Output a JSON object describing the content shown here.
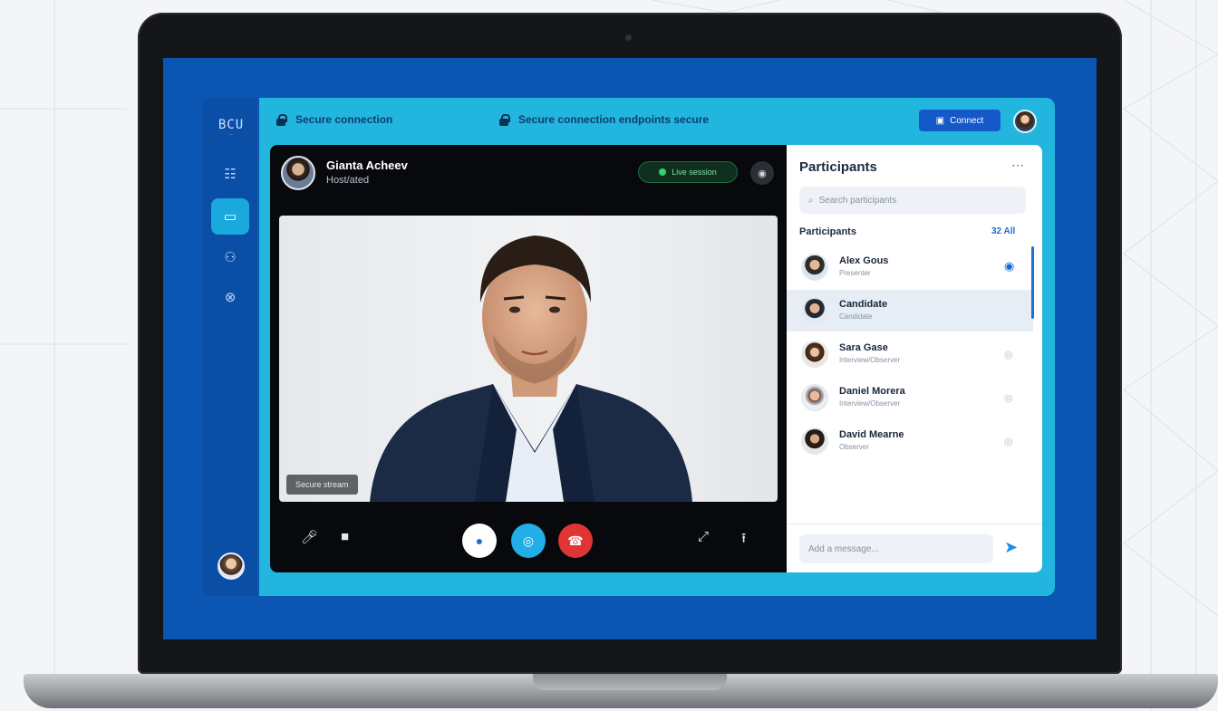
{
  "app": {
    "logo_text": "BCU",
    "logo_sub": "—"
  },
  "topbar": {
    "secure_label_1": "Secure connection",
    "secure_label_2": "Secure connection endpoints secure",
    "connect_label": "Connect"
  },
  "call": {
    "caller_name": "Gianta Acheev",
    "caller_subtitle": "Host/ated",
    "status_label": "Live session",
    "feed_label": "Secure stream"
  },
  "participants": {
    "title": "Participants",
    "search_placeholder": "Search participants",
    "section_label": "Participants",
    "section_count": "32 All",
    "items": [
      {
        "name": "Alex Gous",
        "role": "Presenter",
        "status": "on"
      },
      {
        "name": "Candidate",
        "role": "Candidate",
        "status": "on"
      },
      {
        "name": "Sara Gase",
        "role": "Interview/Observer",
        "status": "off"
      },
      {
        "name": "Daniel Morera",
        "role": "Interview/Observer",
        "status": "off"
      },
      {
        "name": "David Mearne",
        "role": "Observer",
        "status": "off"
      }
    ],
    "message_placeholder": "Add a message..."
  },
  "colors": {
    "accent": "#22b6de",
    "rail": "#0a4ea6",
    "end_call": "#e03535",
    "primary": "#1459c7"
  }
}
